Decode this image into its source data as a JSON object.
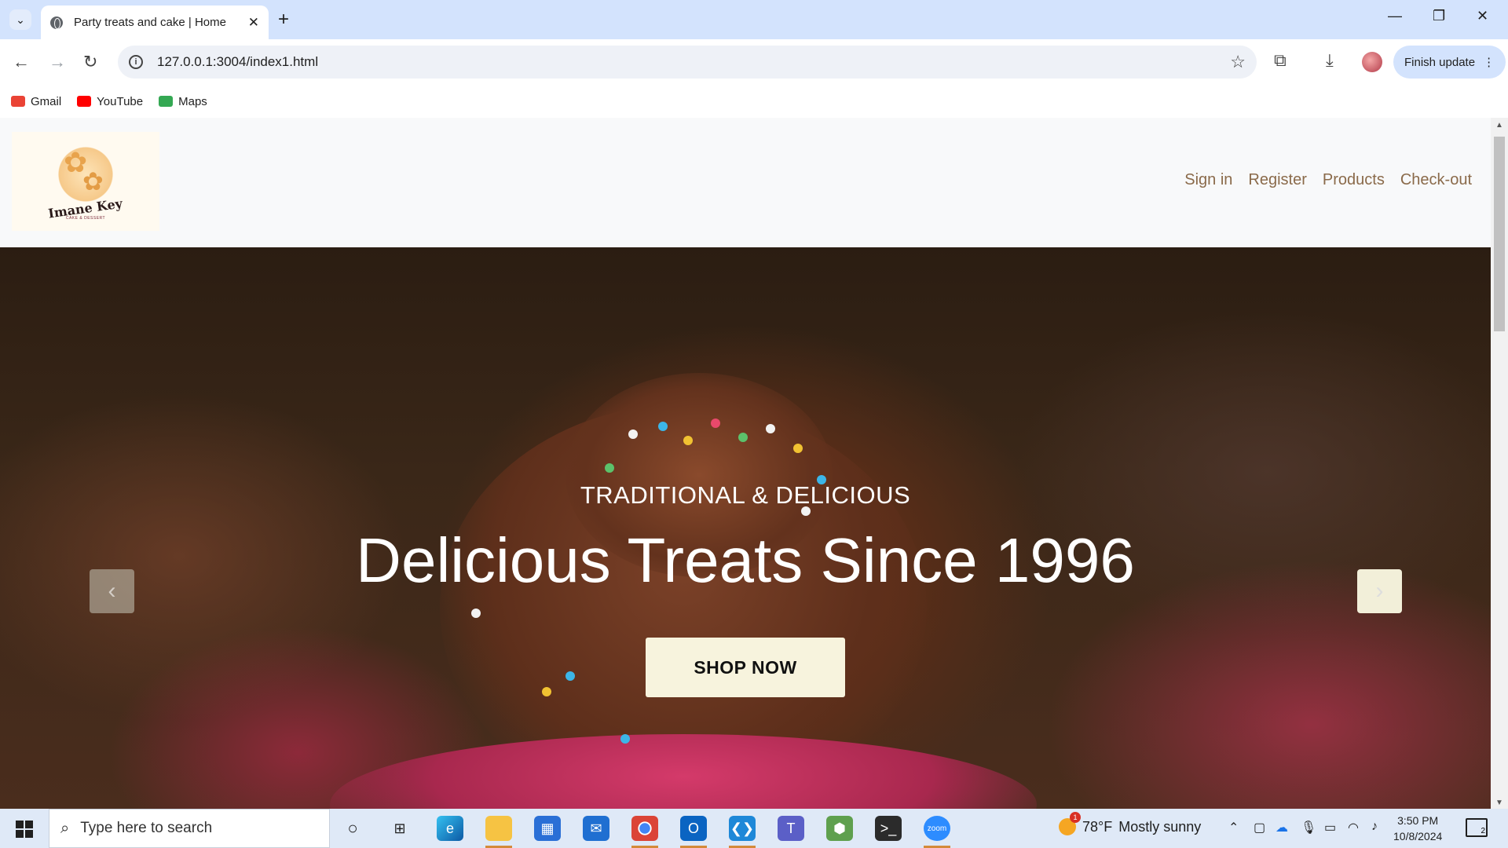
{
  "browser": {
    "tab_title": "Party treats and cake | Home",
    "url": "127.0.0.1:3004/index1.html",
    "finish_update_label": "Finish update",
    "bookmarks": [
      {
        "label": "Gmail",
        "icon": "gmail-icon",
        "color": "#ea4335"
      },
      {
        "label": "YouTube",
        "icon": "youtube-icon",
        "color": "#ff0000"
      },
      {
        "label": "Maps",
        "icon": "maps-icon",
        "color": "#34a853"
      }
    ]
  },
  "site": {
    "logo_text": "Imane Key",
    "logo_subtext": "CAKE & DESSERT",
    "nav": [
      "Sign in",
      "Register",
      "Products",
      "Check-out"
    ],
    "hero": {
      "subtitle": "TRADITIONAL & DELICIOUS",
      "title": "Delicious Treats Since 1996",
      "cta": "SHOP NOW"
    }
  },
  "taskbar": {
    "search_placeholder": "Type here to search",
    "weather_temp": "78°F",
    "weather_desc": "Mostly sunny",
    "weather_badge": "1",
    "time": "3:50 PM",
    "date": "10/8/2024",
    "notification_count": "2",
    "apps": [
      "cortana-icon",
      "task-view-icon",
      "edge-icon",
      "file-explorer-icon",
      "store-icon",
      "mail-icon",
      "chrome-icon",
      "outlook-icon",
      "vscode-icon",
      "teams-icon",
      "nodejs-icon",
      "terminal-icon",
      "zoom-icon"
    ]
  },
  "colors": {
    "nav_link": "#8a6a4a",
    "cta_bg": "#f7f3dd",
    "tabstrip": "#d3e3fd"
  }
}
